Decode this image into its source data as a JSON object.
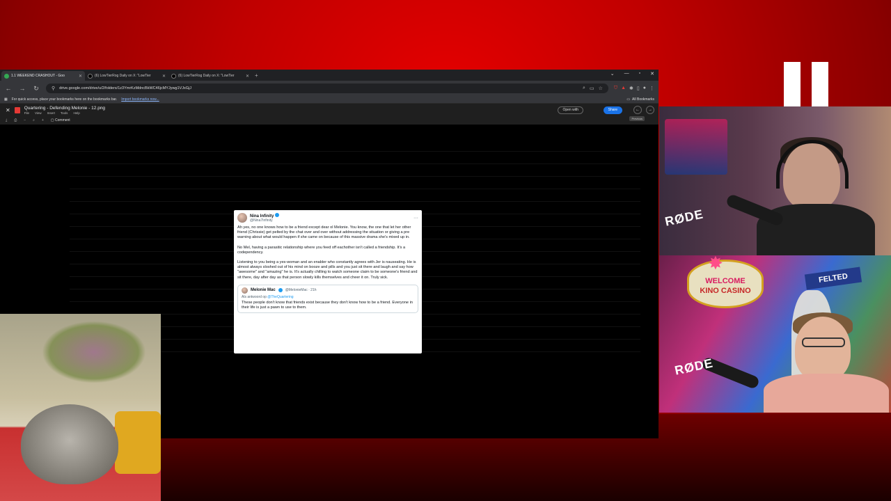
{
  "browser": {
    "tabs": [
      {
        "label": "1.1 WEEKEND CRASHOUT - Goo",
        "active": true,
        "icon": "drive-icon"
      },
      {
        "label": "(6) LowTierRog Daily on X: \"LowTier",
        "active": false,
        "icon": "x-icon"
      },
      {
        "label": "(6) LowTierRog Daily on X: \"LowTier",
        "active": false,
        "icon": "x-icon"
      }
    ],
    "url": "drive.google.com/drive/u/2/folders/1z3YmrKzMdncBkWC46jcMYJywg1VJxGjJ",
    "bookmarks_prompt": "For quick access, place your bookmarks here on the bookmarks bar.",
    "import_link": "Import bookmarks now...",
    "all_bookmarks": "All Bookmarks"
  },
  "viewer": {
    "filename": "Quartering - Defending Melonie - 12.png",
    "menu": [
      "File",
      "View",
      "Insert",
      "Tools",
      "Help"
    ],
    "open_with": "Open with",
    "share": "Share",
    "tooltip": "Previous",
    "comment": "Comment"
  },
  "tweet": {
    "author": "Nina Infinity",
    "handle": "@Nina7Infinity",
    "paragraphs": [
      "Ah yes, no one knows how to be a friend except dear ol Melonie. You know, the one that let her other friend (Chrissie) get pelted by the chat over and over without addressing the situation or giving a pre warning about what would happen if she came on because of this massive drama she's mixed up in.",
      "No Mel, having a parasitic relationship where you feed off eachother isn't called a friendship. It's a codependency.",
      "Listening to you being a yes-woman and an enabler who constantly agrees with Jer is nauseating. He is almost always sloshed out of his mind on booze and pills and you just sit there and laugh and say how \"awesome\" and \"amazing\" he is. It's actually chilling to watch someone claim to be someone's friend and sit there, day after day as that person slowly kills themselves and cheer it on. Truly sick."
    ],
    "quote": {
      "author": "Melonie Mac",
      "handle": "@MelonieMac · 21h",
      "reply_prefix": "Als antwoord op",
      "reply_to": "@TheQuartering",
      "text": "These people don't know that friends exist because they don't know how to be a friend. Everyone in their life is just a pawn to use to them."
    }
  },
  "overlay": {
    "welcome": "WELCOME",
    "casino": "KINO CASINO",
    "felted": "FELTED",
    "mic_brand": "RØDE"
  }
}
